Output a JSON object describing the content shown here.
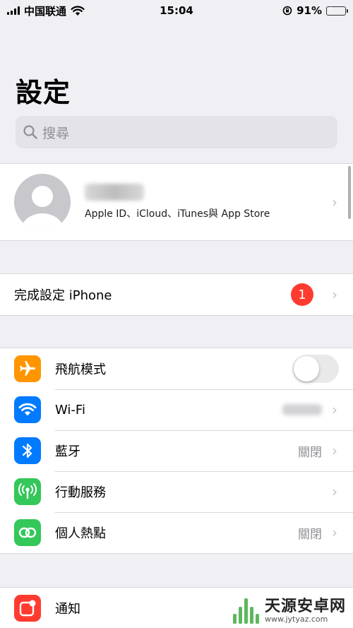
{
  "status_bar": {
    "carrier": "中国联通",
    "time": "15:04",
    "battery_percent": "91%",
    "battery_level": 0.91
  },
  "header": {
    "title": "設定",
    "search_placeholder": "搜尋"
  },
  "profile": {
    "subtitle": "Apple ID、iCloud、iTunes與 App Store"
  },
  "setup": {
    "label": "完成設定 iPhone",
    "badge": "1"
  },
  "connectivity": {
    "airplane": {
      "label": "飛航模式",
      "on": false
    },
    "wifi": {
      "label": "Wi-Fi"
    },
    "bluetooth": {
      "label": "藍牙",
      "value": "關閉"
    },
    "cellular": {
      "label": "行動服務"
    },
    "hotspot": {
      "label": "個人熱點",
      "value": "關閉"
    }
  },
  "notifications": {
    "label": "通知"
  },
  "watermark": {
    "name": "天源安卓网",
    "url": "www.jytyaz.com"
  },
  "colors": {
    "airplane": "#ff9500",
    "wifi": "#007aff",
    "bluetooth": "#007aff",
    "cellular": "#34c759",
    "hotspot": "#34c759",
    "notifications": "#ff3b30",
    "badge": "#ff3b30"
  }
}
